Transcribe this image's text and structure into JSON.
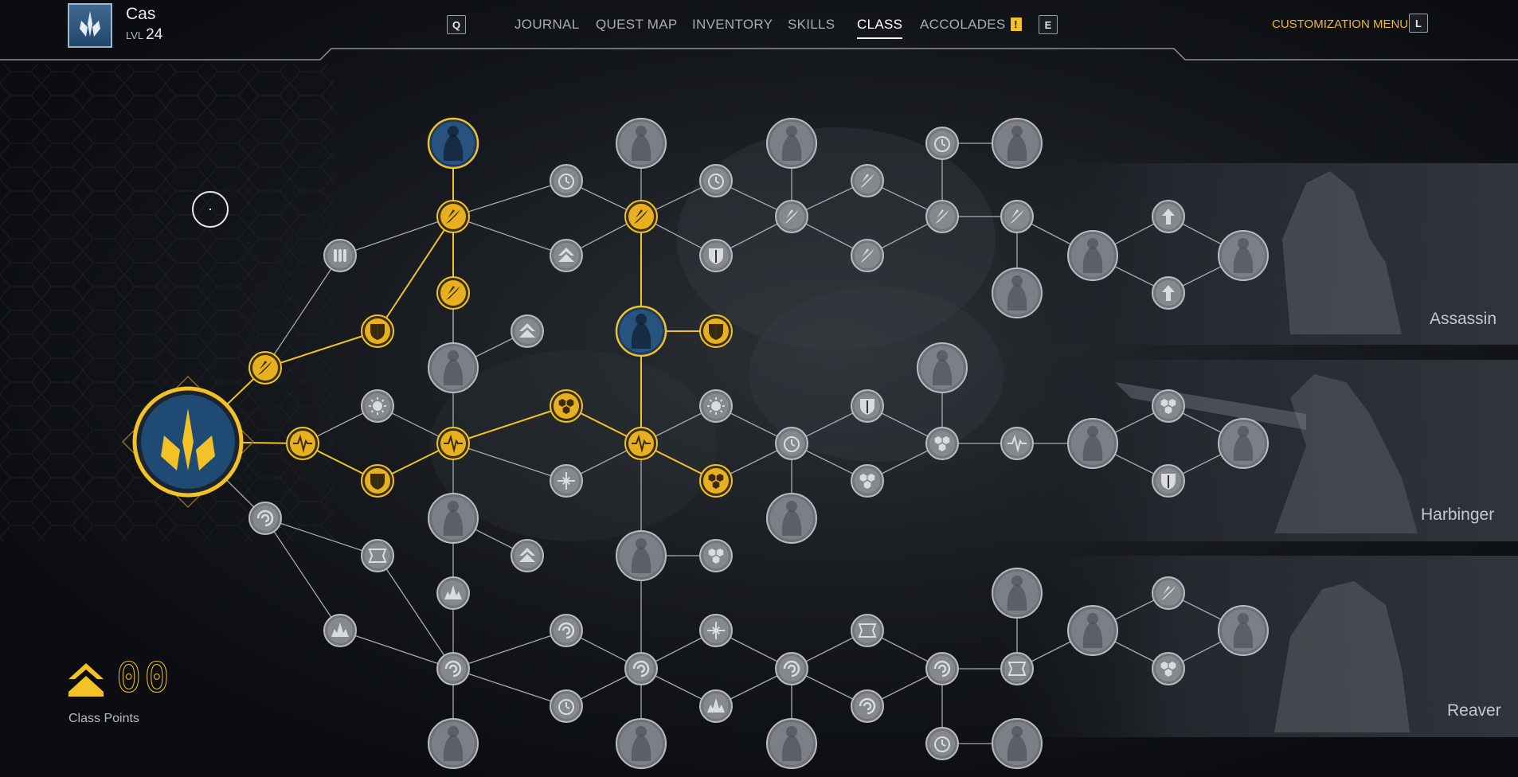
{
  "player": {
    "name": "Cas",
    "level_label": "LVL",
    "level": "24"
  },
  "nav": {
    "key_left": "Q",
    "key_right": "E",
    "items": [
      {
        "label": "JOURNAL"
      },
      {
        "label": "QUEST MAP"
      },
      {
        "label": "INVENTORY"
      },
      {
        "label": "SKILLS"
      },
      {
        "label": "CLASS",
        "active": true
      },
      {
        "label": "ACCOLADES",
        "alert": "!"
      }
    ]
  },
  "customization": {
    "label": "CUSTOMIZATION MENU",
    "key": "L"
  },
  "subclasses": [
    {
      "name": "Assassin"
    },
    {
      "name": "Harbinger"
    },
    {
      "name": "Reaver"
    }
  ],
  "class_points": {
    "value": "00",
    "label": "Class Points"
  },
  "colors": {
    "gold": "#f3c227",
    "inactive_node": "#777b80",
    "inactive_line": "#a7abb0",
    "accent_orange": "#f3b632"
  }
}
